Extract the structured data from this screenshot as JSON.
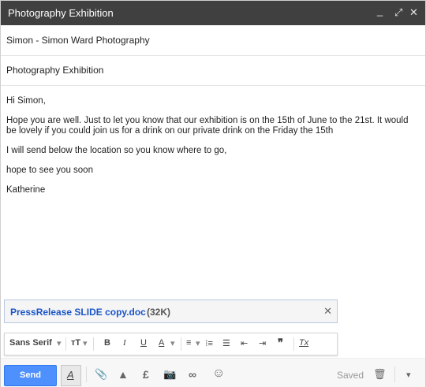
{
  "window": {
    "title": "Photography Exhibition",
    "minimize": "_",
    "expand": "⤢",
    "close": "✕"
  },
  "compose": {
    "to": "Simon - Simon Ward Photography",
    "subject": "Photography Exhibition",
    "body": [
      "Hi Simon,",
      "Hope you are well. Just to let you know that our exhibition is on the 15th of June to the 21st. It would be lovely if you could join us for a drink on our private drink on the Friday the 15th",
      "I will send below the location so you know where to go,",
      "hope to see you soon",
      "Katherine"
    ]
  },
  "attachment": {
    "name": "PressRelease SLIDE copy.doc",
    "size": "(32K)",
    "remove": "✕"
  },
  "format": {
    "font": "Sans Serif",
    "size": "тT",
    "bold": "B",
    "italic": "I",
    "underline": "U",
    "color": "A",
    "align": "≡",
    "ordered": "⁝≡",
    "bullets": "☰",
    "indent_less": "⇤",
    "indent_more": "⇥",
    "quote": "❞",
    "clear": "Tx",
    "caret": "▾"
  },
  "toolbar": {
    "send": "Send",
    "formatting": "A",
    "attach": "📎",
    "drive": "▲",
    "money": "£",
    "photo": "📷",
    "link": "∞",
    "emoji": "☺",
    "saved": "Saved",
    "trash": "🗑",
    "more": "▾"
  }
}
